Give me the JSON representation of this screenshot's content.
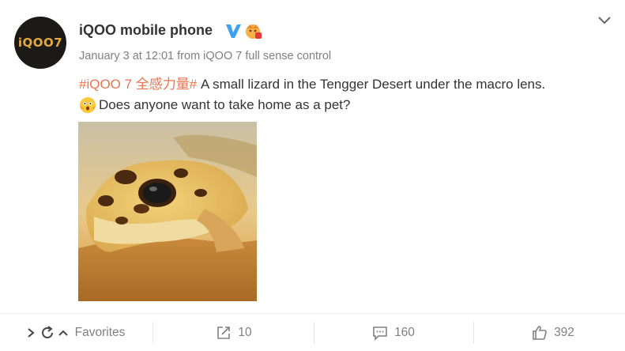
{
  "post": {
    "avatar_text": "iQOO7",
    "author": "iQOO mobile phone",
    "timestamp": "January 3 at 12:01 from iQOO 7 full sense control",
    "hashtag": "#iQOO 7 全感力量#",
    "text_line1": " A small lizard in the Tengger Desert under the macro lens.",
    "text_line2": "Does anyone want to take home as a pet?",
    "image_alt": "lizard-photo"
  },
  "actions": {
    "favorites_label": "Favorites",
    "repost_count": "10",
    "comment_count": "160",
    "like_count": "392"
  },
  "colors": {
    "hashtag": "#eb7350",
    "verify": "#3da1f5",
    "muted": "#808080"
  },
  "icons": [
    "chevron-down-icon",
    "verified-v-icon",
    "member-badge-icon",
    "shocked-emoji-icon",
    "expand-arrow-icon",
    "refresh-icon",
    "repost-icon",
    "comment-icon",
    "like-icon"
  ]
}
